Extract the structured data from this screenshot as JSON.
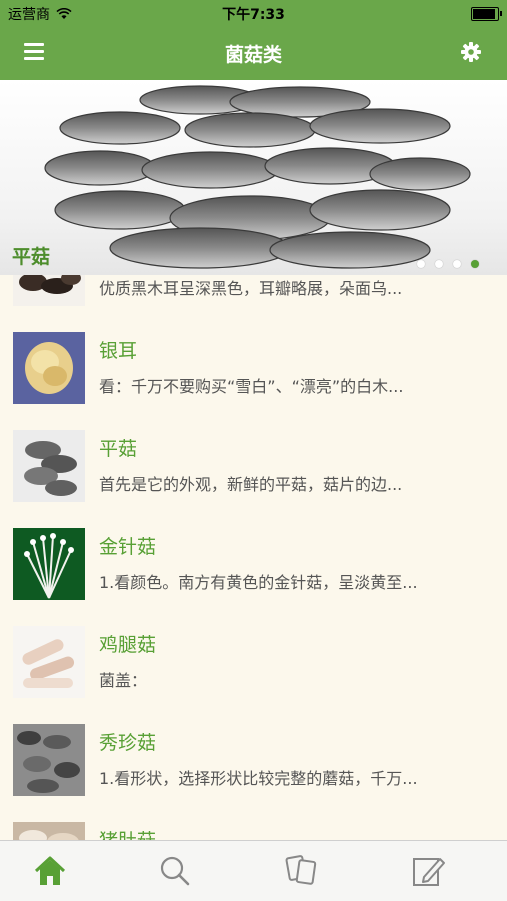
{
  "status_bar": {
    "carrier": "运营商",
    "time": "下午7:33"
  },
  "nav": {
    "title": "菌菇类",
    "menu_icon": "menu-icon",
    "settings_icon": "gear-icon"
  },
  "banner": {
    "caption": "平菇",
    "page_count": 4,
    "active_page": 4
  },
  "list": [
    {
      "title": "",
      "desc": "优质黑木耳呈深黑色，耳瓣略展，朵面乌..."
    },
    {
      "title": "银耳",
      "desc": "看：千万不要购买“雪白”、“漂亮”的白木..."
    },
    {
      "title": "平菇",
      "desc": "首先是它的外观，新鲜的平菇，菇片的边..."
    },
    {
      "title": "金针菇",
      "desc": "1.看颜色。南方有黄色的金针菇，呈淡黄至..."
    },
    {
      "title": "鸡腿菇",
      "desc": "菌盖："
    },
    {
      "title": "秀珍菇",
      "desc": "1.看形状，选择形状比较完整的蘑菇，千万..."
    },
    {
      "title": "猪肚菇",
      "desc": ""
    }
  ],
  "tabbar": {
    "items": [
      "home-icon",
      "search-icon",
      "cards-icon",
      "edit-icon"
    ],
    "active_color": "#58a035",
    "inactive_color": "#888888"
  },
  "colors": {
    "accent": "#6aa74a",
    "title_green": "#58a035",
    "background": "#fcf8ec"
  }
}
